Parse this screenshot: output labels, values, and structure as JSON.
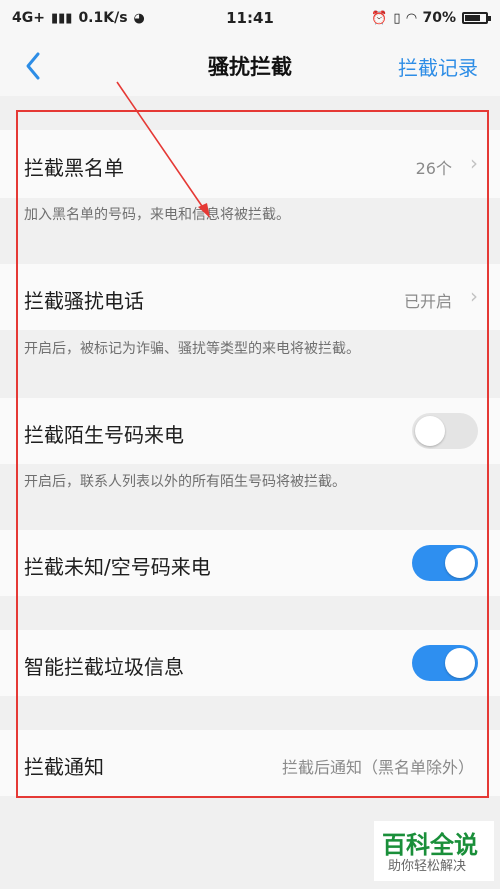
{
  "status_bar": {
    "network": "4G+",
    "speed": "0.1K/s",
    "time": "11:41",
    "battery": "70%"
  },
  "nav": {
    "title": "骚扰拦截",
    "right_action": "拦截记录"
  },
  "settings": {
    "blacklist": {
      "label": "拦截黑名单",
      "value": "26个",
      "desc": "加入黑名单的号码，来电和信息将被拦截。"
    },
    "harass_calls": {
      "label": "拦截骚扰电话",
      "value": "已开启",
      "desc": "开启后，被标记为诈骗、骚扰等类型的来电将被拦截。"
    },
    "stranger_calls": {
      "label": "拦截陌生号码来电",
      "toggle": false,
      "desc": "开启后，联系人列表以外的所有陌生号码将被拦截。"
    },
    "unknown_calls": {
      "label": "拦截未知/空号码来电",
      "toggle": true
    },
    "spam_messages": {
      "label": "智能拦截垃圾信息",
      "toggle": true
    },
    "notification": {
      "label": "拦截通知",
      "value": "拦截后通知（黑名单除外）"
    }
  },
  "watermark": {
    "main": "百科全说",
    "sub": "助你轻松解决"
  },
  "colors": {
    "accent": "#2e8ff0",
    "annotation": "#e53935",
    "watermark": "#1a8f3a"
  }
}
